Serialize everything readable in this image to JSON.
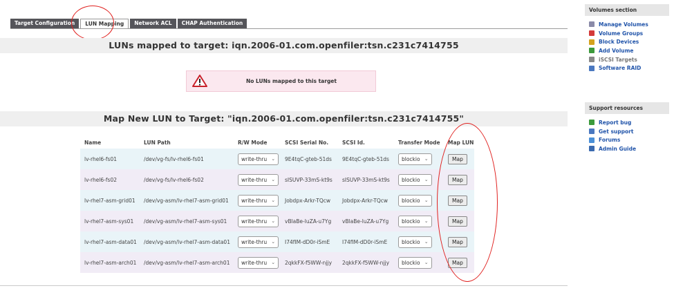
{
  "tabs": [
    {
      "label": "Target Configuration",
      "active": false
    },
    {
      "label": "LUN Mapping",
      "active": true
    },
    {
      "label": "Network ACL",
      "active": false
    },
    {
      "label": "CHAP Authentication",
      "active": false
    }
  ],
  "mapped_title": "LUNs mapped to target: iqn.2006-01.com.openfiler:tsn.c231c7414755",
  "warning": {
    "text": "No LUNs mapped to this target",
    "icon": "warning-icon"
  },
  "map_new_title": "Map New LUN to Target: \"iqn.2006-01.com.openfiler:tsn.c231c7414755\"",
  "table": {
    "headers": [
      "Name",
      "LUN Path",
      "R/W Mode",
      "SCSI Serial No.",
      "SCSI Id.",
      "Transfer Mode",
      "Map LUN"
    ],
    "rows": [
      {
        "name": "lv-rhel6-fs01",
        "path": "/dev/vg-fs/lv-rhel6-fs01",
        "rw": "write-thru",
        "serial": "9E4tqC-gteb-51ds",
        "scsi_id": "9E4tqC-gteb-51ds",
        "transfer": "blockio",
        "map": "Map"
      },
      {
        "name": "lv-rhel6-fs02",
        "path": "/dev/vg-fs/lv-rhel6-fs02",
        "rw": "write-thru",
        "serial": "sISUVP-33mS-kt9s",
        "scsi_id": "sISUVP-33mS-kt9s",
        "transfer": "blockio",
        "map": "Map"
      },
      {
        "name": "lv-rhel7-asm-grid01",
        "path": "/dev/vg-asm/lv-rhel7-asm-grid01",
        "rw": "write-thru",
        "serial": "Jobdpx-Arkr-TQcw",
        "scsi_id": "Jobdpx-Arkr-TQcw",
        "transfer": "blockio",
        "map": "Map"
      },
      {
        "name": "lv-rhel7-asm-sys01",
        "path": "/dev/vg-asm/lv-rhel7-asm-sys01",
        "rw": "write-thru",
        "serial": "vBlaBe-luZA-u7Yg",
        "scsi_id": "vBlaBe-luZA-u7Yg",
        "transfer": "blockio",
        "map": "Map"
      },
      {
        "name": "lv-rhel7-asm-data01",
        "path": "/dev/vg-asm/lv-rhel7-asm-data01",
        "rw": "write-thru",
        "serial": "I74fIM-dD0r-iSmE",
        "scsi_id": "I74fIM-dD0r-iSmE",
        "transfer": "blockio",
        "map": "Map"
      },
      {
        "name": "lv-rhel7-asm-arch01",
        "path": "/dev/vg-asm/lv-rhel7-asm-arch01",
        "rw": "write-thru",
        "serial": "2qkkFX-f5WW-njjy",
        "scsi_id": "2qkkFX-f5WW-njjy",
        "transfer": "blockio",
        "map": "Map"
      }
    ]
  },
  "volumes_section": {
    "title": "Volumes section",
    "items": [
      {
        "label": "Manage Volumes",
        "icon": "manage-volumes-icon",
        "color": "#8a8aa8",
        "disabled": false
      },
      {
        "label": "Volume Groups",
        "icon": "volume-groups-icon",
        "color": "#d43a3a",
        "disabled": false
      },
      {
        "label": "Block Devices",
        "icon": "block-devices-icon",
        "color": "#d4a21e",
        "disabled": false
      },
      {
        "label": "Add Volume",
        "icon": "add-volume-icon",
        "color": "#3c9a3c",
        "disabled": false
      },
      {
        "label": "iSCSI Targets",
        "icon": "iscsi-targets-icon",
        "color": "#888888",
        "disabled": true
      },
      {
        "label": "Software RAID",
        "icon": "software-raid-icon",
        "color": "#4a78c0",
        "disabled": false
      }
    ]
  },
  "support_section": {
    "title": "Support resources",
    "items": [
      {
        "label": "Report bug",
        "icon": "report-bug-icon",
        "color": "#3c9a3c",
        "disabled": false
      },
      {
        "label": "Get support",
        "icon": "get-support-icon",
        "color": "#4a78c0",
        "disabled": false
      },
      {
        "label": "Forums",
        "icon": "forums-icon",
        "color": "#4a90d8",
        "disabled": false
      },
      {
        "label": "Admin Guide",
        "icon": "admin-guide-icon",
        "color": "#3a6ab0",
        "disabled": false
      }
    ]
  },
  "colors": {
    "accent_link": "#2255aa",
    "annotation_red": "#e0201e",
    "warning_bg": "#fbe8ef"
  }
}
